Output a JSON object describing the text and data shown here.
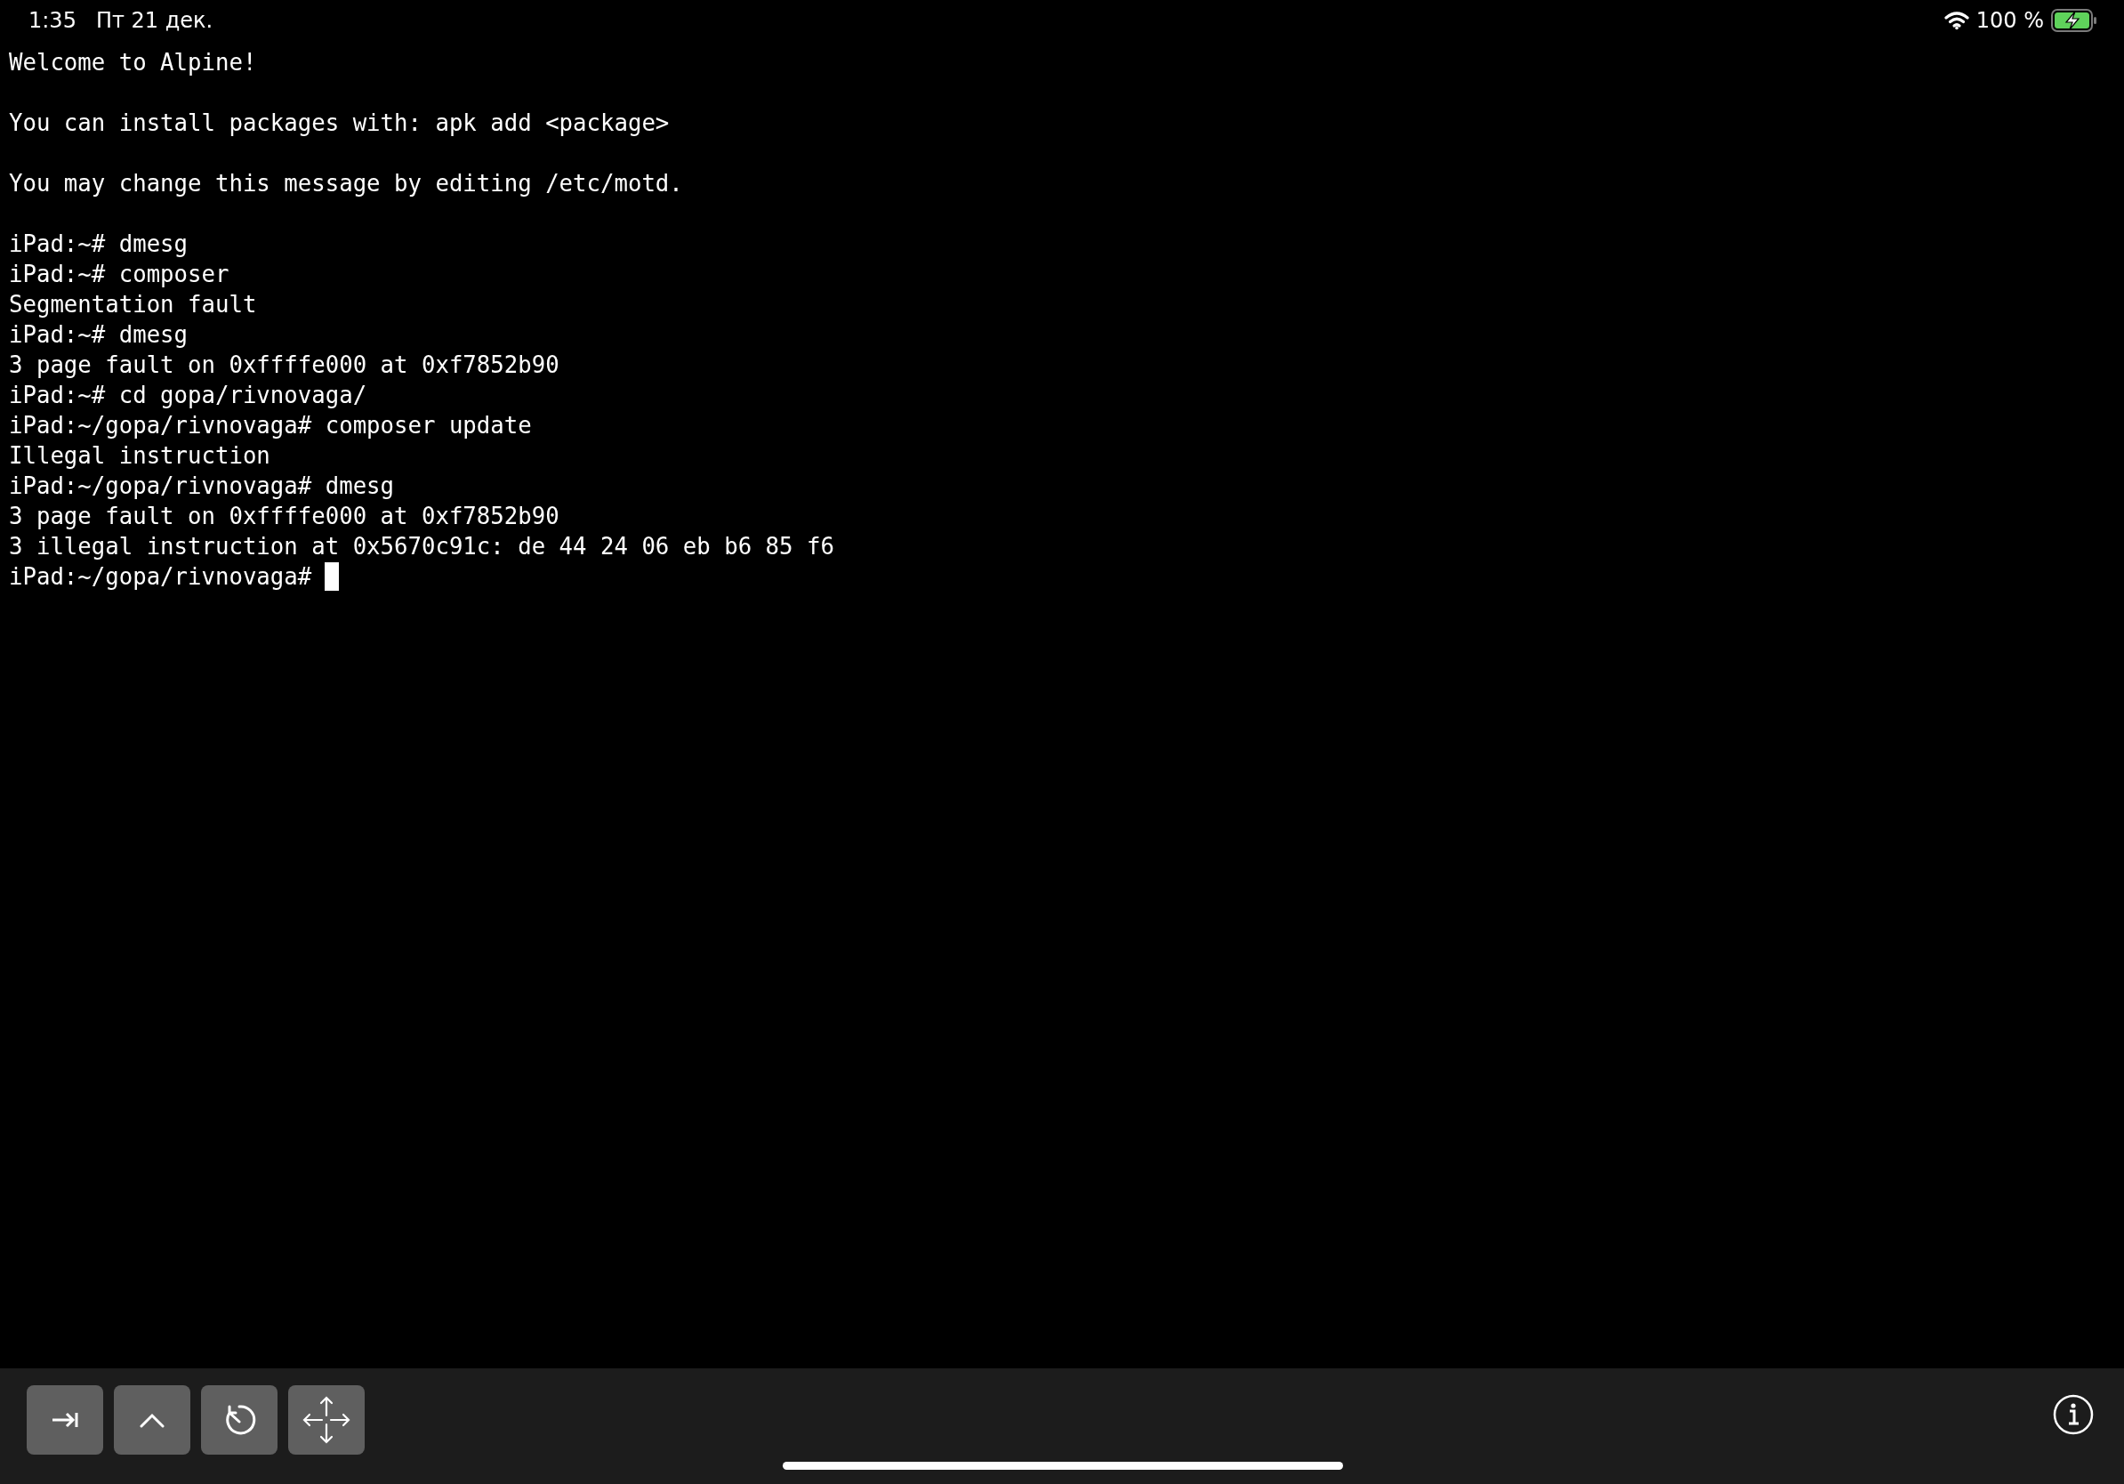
{
  "status_bar": {
    "time": "1:35",
    "date": "Пт 21 дек.",
    "battery_text": "100 %",
    "charging": true
  },
  "terminal": {
    "motd": [
      "Welcome to Alpine!",
      "You can install packages with: apk add <package>",
      "You may change this message by editing /etc/motd."
    ],
    "session": [
      "iPad:~# dmesg",
      "iPad:~# composer",
      "Segmentation fault",
      "iPad:~# dmesg",
      "3 page fault on 0xffffe000 at 0xf7852b90",
      "iPad:~# cd gopa/rivnovaga/",
      "iPad:~/gopa/rivnovaga# composer update",
      "Illegal instruction",
      "iPad:~/gopa/rivnovaga# dmesg",
      "3 page fault on 0xffffe000 at 0xf7852b90",
      "3 illegal instruction at 0x5670c91c: de 44 24 06 eb b6 85 f6"
    ],
    "prompt": "iPad:~/gopa/rivnovaga#"
  }
}
